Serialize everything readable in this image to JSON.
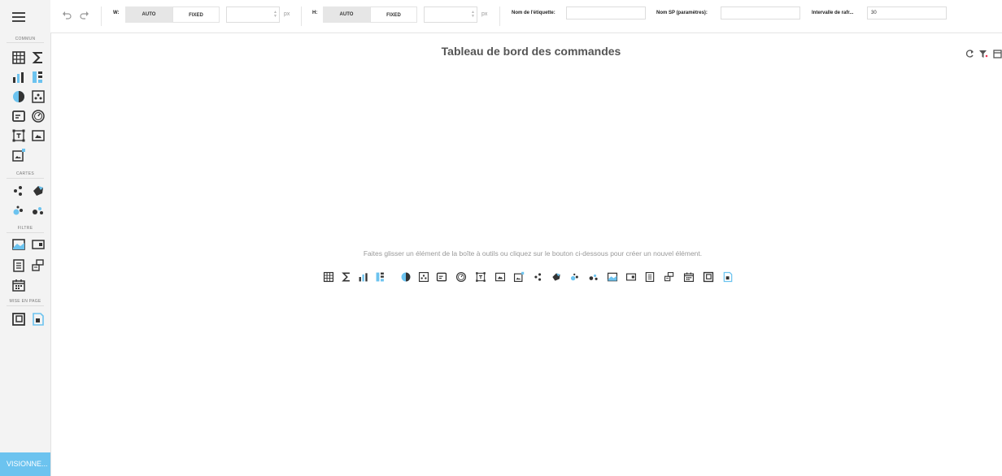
{
  "sidebar": {
    "sections": {
      "common": "COMMUN",
      "maps": "CARTES",
      "filter": "FILTRE",
      "layout": "MISE EN PAGE"
    },
    "view_button": "VISIONNE..."
  },
  "toolbar": {
    "width_label": "W:",
    "height_label": "H:",
    "auto": "AUTO",
    "fixed": "FIXED",
    "px": "px",
    "width_value": "",
    "height_value": "",
    "label_name": "Nom de l'étiquette:",
    "label_value": "",
    "sp_name": "Nom SP (paramètres):",
    "sp_value": "",
    "refresh_label": "Intervalle de rafr...",
    "refresh_value": "30"
  },
  "dashboard": {
    "title": "Tableau de bord des commandes",
    "hint": "Faites glisser un élément de la boîte à outils ou cliquez sur le bouton ci-dessous pour créer un nouvel élément."
  },
  "colors": {
    "accent": "#6cc3ef",
    "icon": "#333333"
  }
}
